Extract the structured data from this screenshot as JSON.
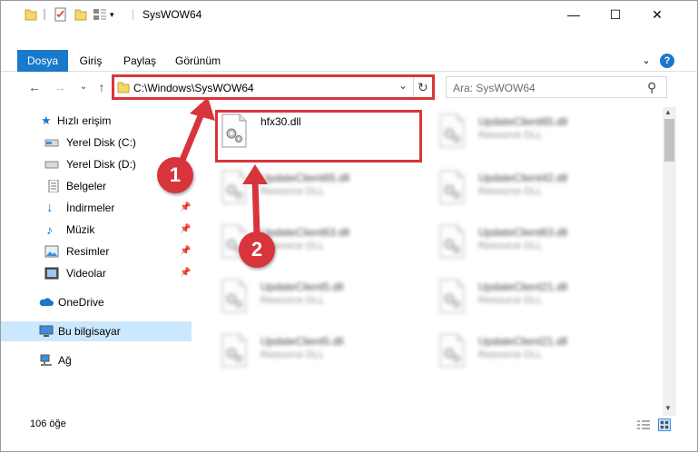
{
  "window": {
    "title": "SysWOW64",
    "controls": {
      "minimize": "—",
      "maximize": "☐",
      "close": "✕"
    }
  },
  "ribbon": {
    "tabs": [
      "Dosya",
      "Giriş",
      "Paylaş",
      "Görünüm"
    ],
    "expand_icon": "chevron-down-icon",
    "help_icon": "?"
  },
  "navigation": {
    "back": "←",
    "forward": "→",
    "recent": "⌄",
    "up": "↑",
    "address": "C:\\Windows\\SysWOW64",
    "dropdown": "⌄",
    "refresh": "↻"
  },
  "search": {
    "placeholder": "Ara: SysWOW64",
    "icon": "⚲"
  },
  "sidebar": {
    "items": [
      {
        "label": "Hızlı erişim",
        "icon": "star-icon",
        "pinned": false
      },
      {
        "label": "Yerel Disk (C:)",
        "icon": "drive-icon",
        "pinned": false
      },
      {
        "label": "Yerel Disk (D:)",
        "icon": "drive-icon",
        "pinned": false
      },
      {
        "label": "Belgeler",
        "icon": "documents-icon",
        "pinned": true
      },
      {
        "label": "İndirmeler",
        "icon": "download-icon",
        "pinned": true
      },
      {
        "label": "Müzik",
        "icon": "music-icon",
        "pinned": true
      },
      {
        "label": "Resimler",
        "icon": "pictures-icon",
        "pinned": true
      },
      {
        "label": "Videolar",
        "icon": "videos-icon",
        "pinned": true
      },
      {
        "label": "OneDrive",
        "icon": "cloud-icon",
        "pinned": false
      },
      {
        "label": "Bu bilgisayar",
        "icon": "computer-icon",
        "pinned": false,
        "selected": true
      },
      {
        "label": "Ağ",
        "icon": "network-icon",
        "pinned": false
      }
    ],
    "pin_glyph": "📌"
  },
  "files": [
    {
      "name": "hfx30.dll",
      "type": "",
      "blurred": false
    },
    {
      "name": "UpdateClient65.dll",
      "type": "Resource DLL",
      "blurred": true
    },
    {
      "name": "UpdateClient65.dll",
      "type": "Resource DLL",
      "blurred": true
    },
    {
      "name": "UpdateClient42.dll",
      "type": "Resource DLL",
      "blurred": true
    },
    {
      "name": "UpdateClient63.dll",
      "type": "Resource DLL",
      "blurred": true
    },
    {
      "name": "UpdateClient63.dll",
      "type": "Resource DLL",
      "blurred": true
    },
    {
      "name": "UpdateClient5.dll",
      "type": "Resource DLL",
      "blurred": true
    },
    {
      "name": "UpdateClient21.dll",
      "type": "Resource DLL",
      "blurred": true
    },
    {
      "name": "UpdateClient5.dll",
      "type": "Resource DLL",
      "blurred": true
    },
    {
      "name": "UpdateClient21.dll",
      "type": "Resource DLL",
      "blurred": true
    }
  ],
  "status": {
    "item_count": "106 öğe"
  },
  "annotations": {
    "marker_1": "1",
    "marker_2": "2",
    "color": "#d7353b"
  },
  "colors": {
    "file_tab": "#1979ca",
    "selected_nav": "#cce8ff",
    "highlight": "#d7353b"
  }
}
